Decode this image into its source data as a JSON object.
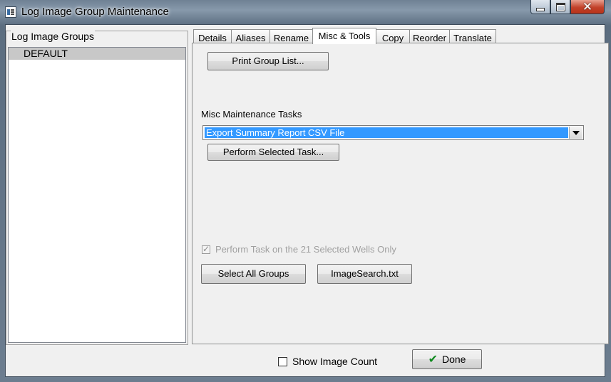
{
  "window": {
    "title": "Log Image Group Maintenance",
    "icons": {
      "app": "log-image-app-icon",
      "minimize": "minimize-icon",
      "maximize": "maximize-icon",
      "close": "close-icon"
    }
  },
  "groups": {
    "label": "Log Image Groups",
    "items": [
      "DEFAULT"
    ],
    "selected": "DEFAULT"
  },
  "tabs": [
    {
      "label": "Details"
    },
    {
      "label": "Aliases"
    },
    {
      "label": "Rename"
    },
    {
      "label": "Misc & Tools"
    },
    {
      "label": "Copy"
    },
    {
      "label": "Reorder"
    },
    {
      "label": "Translate"
    }
  ],
  "active_tab": "Misc & Tools",
  "misc_tools": {
    "print_group_list_label": "Print Group List...",
    "tasks_label": "Misc Maintenance Tasks",
    "task_selected": "Export Summary Report CSV File",
    "perform_task_label": "Perform Selected Task...",
    "selected_wells_label": "Perform Task on the 21 Selected Wells Only",
    "selected_wells_checked": true,
    "selected_wells_enabled": false,
    "select_all_groups_label": "Select All Groups",
    "imagesearch_label": "ImageSearch.txt"
  },
  "footer": {
    "show_count_label": "Show Image Count",
    "show_count_checked": false,
    "done_label": "Done"
  },
  "colors": {
    "selection": "#3399ff",
    "done_check": "#0f8a1e",
    "close_button": "#c2412a"
  }
}
